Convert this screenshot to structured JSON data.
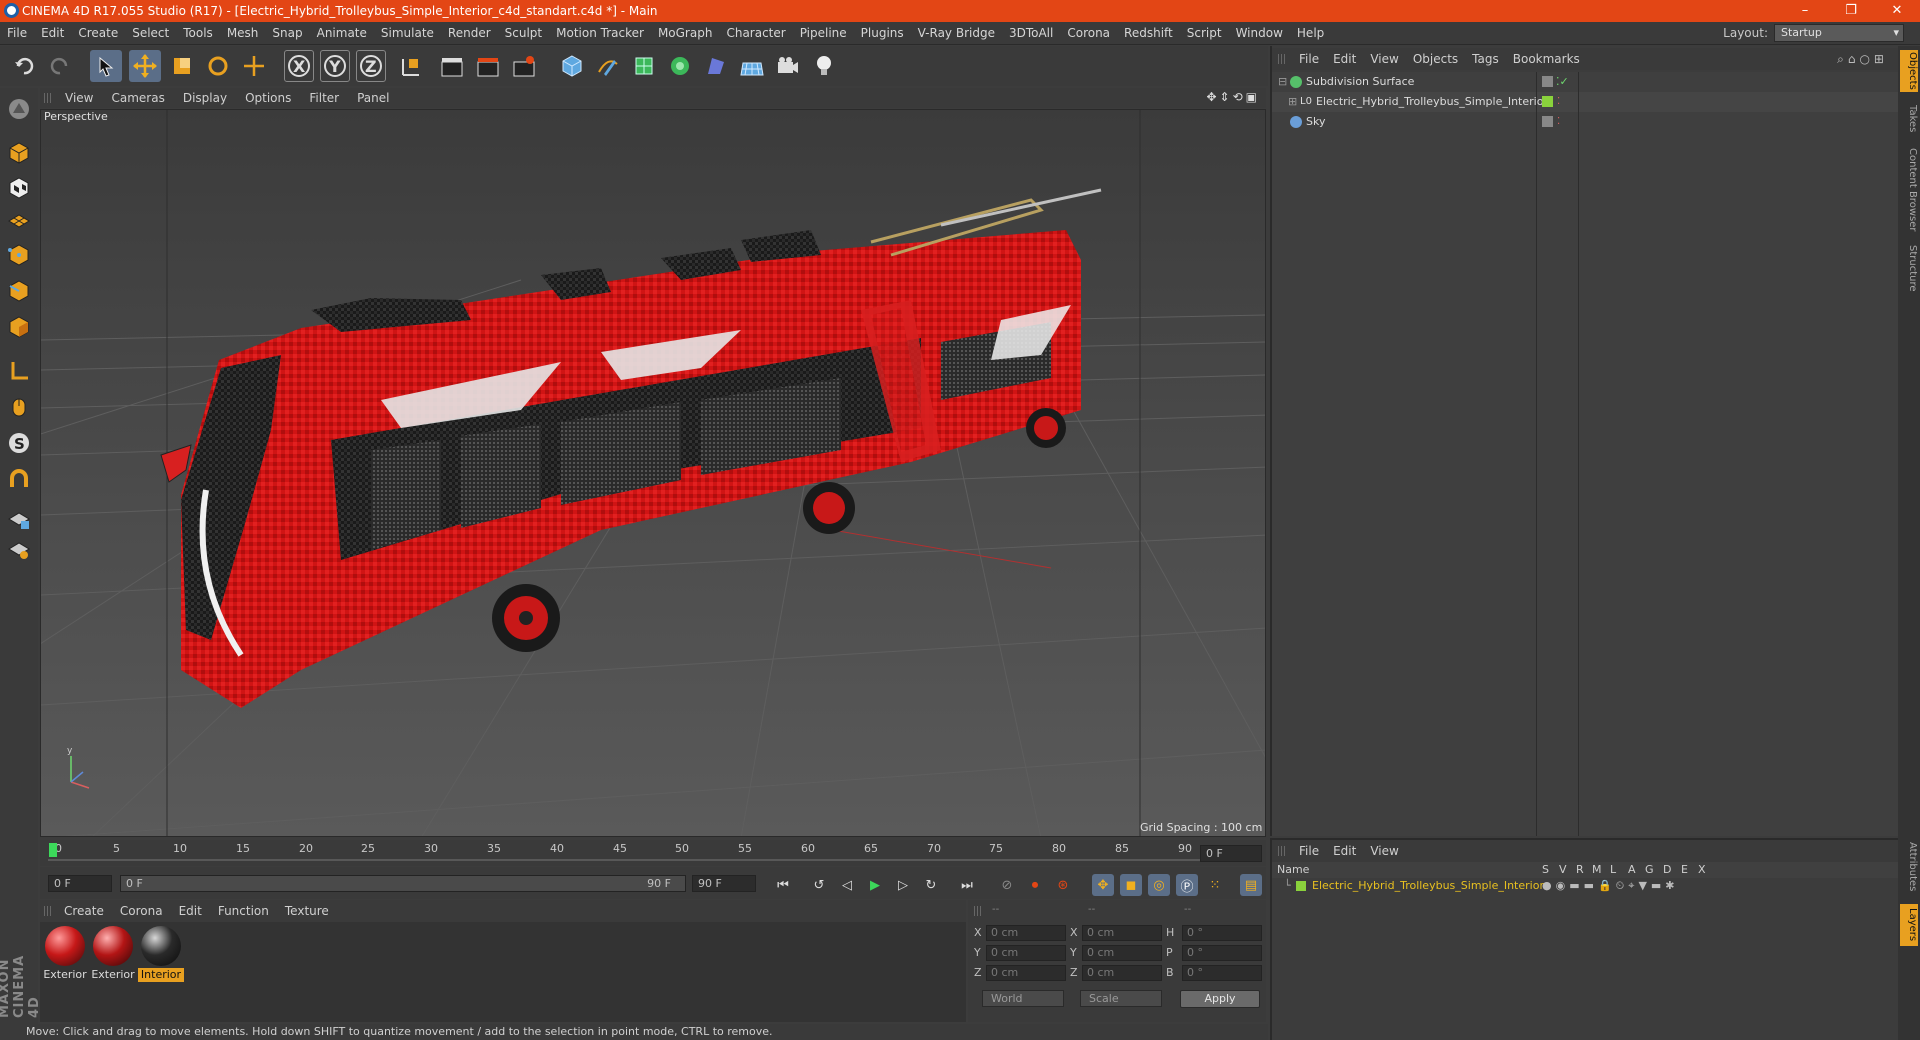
{
  "title_bar": {
    "text": "CINEMA 4D R17.055 Studio (R17) - [Electric_Hybrid_Trolleybus_Simple_Interior_c4d_standart.c4d *] - Main",
    "min": "–",
    "max": "❐",
    "close": "✕"
  },
  "menubar": {
    "items": [
      "File",
      "Edit",
      "Create",
      "Select",
      "Tools",
      "Mesh",
      "Snap",
      "Animate",
      "Simulate",
      "Render",
      "Sculpt",
      "Motion Tracker",
      "MoGraph",
      "Character",
      "Pipeline",
      "Plugins",
      "V-Ray Bridge",
      "3DToAll",
      "Corona",
      "Redshift",
      "Script",
      "Window",
      "Help"
    ],
    "layout_label": "Layout:",
    "layout_value": "Startup"
  },
  "axis_buttons": [
    "X",
    "Y",
    "Z"
  ],
  "viewport": {
    "menu": [
      "View",
      "Cameras",
      "Display",
      "Options",
      "Filter",
      "Panel"
    ],
    "label": "Perspective",
    "grid_spacing": "Grid Spacing : 100 cm"
  },
  "timeline": {
    "ticks": [
      "0",
      "5",
      "10",
      "15",
      "20",
      "25",
      "30",
      "35",
      "40",
      "45",
      "50",
      "55",
      "60",
      "65",
      "70",
      "75",
      "80",
      "85",
      "90"
    ],
    "current_frame": "0 F",
    "start_field": "0 F",
    "slider_start": "0 F",
    "slider_end": "90 F",
    "end_field": "90 F"
  },
  "materials": {
    "menu": [
      "Create",
      "Corona",
      "Edit",
      "Function",
      "Texture"
    ],
    "items": [
      {
        "label": "Exterior",
        "color": "#c61818"
      },
      {
        "label": "Exterior",
        "color": "#b31515"
      },
      {
        "label": "Interior",
        "color": "#2a2a2a"
      }
    ]
  },
  "coords": {
    "headers": [
      "--",
      "--",
      "--"
    ],
    "rows": [
      {
        "a": "X",
        "av": "0 cm",
        "b": "X",
        "bv": "0 cm",
        "c": "H",
        "cv": "0 °"
      },
      {
        "a": "Y",
        "av": "0 cm",
        "b": "Y",
        "bv": "0 cm",
        "c": "P",
        "cv": "0 °"
      },
      {
        "a": "Z",
        "av": "0 cm",
        "b": "Z",
        "bv": "0 cm",
        "c": "B",
        "cv": "0 °"
      }
    ],
    "mode": "World",
    "scale": "Scale",
    "apply": "Apply"
  },
  "status_text": "Move: Click and drag to move elements. Hold down SHIFT to quantize movement / add to the selection in point mode, CTRL to remove.",
  "object_manager": {
    "menu": [
      "File",
      "Edit",
      "View",
      "Objects",
      "Tags",
      "Bookmarks"
    ],
    "objects": [
      {
        "name": "Subdivision Surface",
        "icon_color": "#56c06a"
      },
      {
        "name": "Electric_Hybrid_Trolleybus_Simple_Interior",
        "icon_color": "#cfcfcf"
      },
      {
        "name": "Sky",
        "icon_color": "#6a9ed8"
      }
    ]
  },
  "layer_manager": {
    "menu": [
      "File",
      "Edit",
      "View"
    ],
    "columns": [
      "Name",
      "S",
      "V",
      "R",
      "M",
      "L",
      "A",
      "G",
      "D",
      "E",
      "X"
    ],
    "layer_name": "Electric_Hybrid_Trolleybus_Simple_Interior",
    "layer_color": "#8ad23c"
  },
  "side_tabs": [
    "Objects",
    "Takes",
    "Content Browser",
    "Structure",
    "Attributes",
    "Layers"
  ],
  "branding": "MAXON CINEMA 4D",
  "colors": {
    "title_bar": "#e34615",
    "accent": "#e8a020",
    "bus_red": "#d01414"
  }
}
